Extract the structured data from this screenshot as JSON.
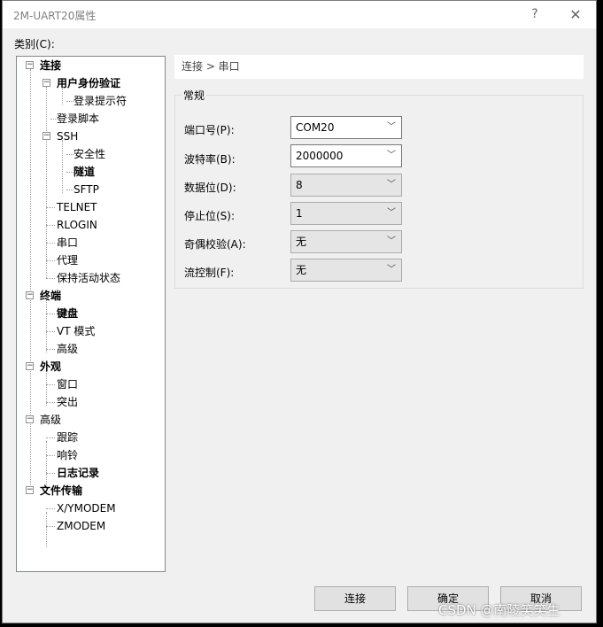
{
  "window": {
    "title": "2M-UART20属性",
    "help": "?",
    "close": "✕"
  },
  "category_label": "类别(C):",
  "tree": [
    {
      "label": "连接",
      "bold": true
    },
    {
      "label": "用户身份验证",
      "bold": true
    },
    {
      "label": "登录提示符",
      "bold": false
    },
    {
      "label": "登录脚本",
      "bold": false
    },
    {
      "label": "SSH",
      "bold": false
    },
    {
      "label": "安全性",
      "bold": false
    },
    {
      "label": "隧道",
      "bold": true
    },
    {
      "label": "SFTP",
      "bold": false
    },
    {
      "label": "TELNET",
      "bold": false
    },
    {
      "label": "RLOGIN",
      "bold": false
    },
    {
      "label": "串口",
      "bold": false
    },
    {
      "label": "代理",
      "bold": false
    },
    {
      "label": "保持活动状态",
      "bold": false
    },
    {
      "label": "终端",
      "bold": true
    },
    {
      "label": "键盘",
      "bold": true
    },
    {
      "label": "VT 模式",
      "bold": false
    },
    {
      "label": "高级",
      "bold": false
    },
    {
      "label": "外观",
      "bold": true
    },
    {
      "label": "窗口",
      "bold": false
    },
    {
      "label": "突出",
      "bold": false
    },
    {
      "label": "高级",
      "bold": false
    },
    {
      "label": "跟踪",
      "bold": false
    },
    {
      "label": "响铃",
      "bold": false
    },
    {
      "label": "日志记录",
      "bold": true
    },
    {
      "label": "文件传输",
      "bold": true
    },
    {
      "label": "X/YMODEM",
      "bold": false
    },
    {
      "label": "ZMODEM",
      "bold": false
    }
  ],
  "breadcrumb": "连接 > 串口",
  "group_title": "常规",
  "fields": [
    {
      "label": "端口号(P):",
      "value": "COM20"
    },
    {
      "label": "波特率(B):",
      "value": "2000000"
    },
    {
      "label": "数据位(D):",
      "value": "8"
    },
    {
      "label": "停止位(S):",
      "value": "1"
    },
    {
      "label": "奇偶校验(A):",
      "value": "无"
    },
    {
      "label": "流控制(F):",
      "value": "无"
    }
  ],
  "buttons": {
    "connect": "连接",
    "ok": "确定",
    "cancel": "取消"
  },
  "watermark": "CSDN @南陵笑笑生",
  "colors": {
    "window_bg": "#f0f0f0",
    "tree_bg": "#ffffff",
    "title_text": "#808080"
  }
}
